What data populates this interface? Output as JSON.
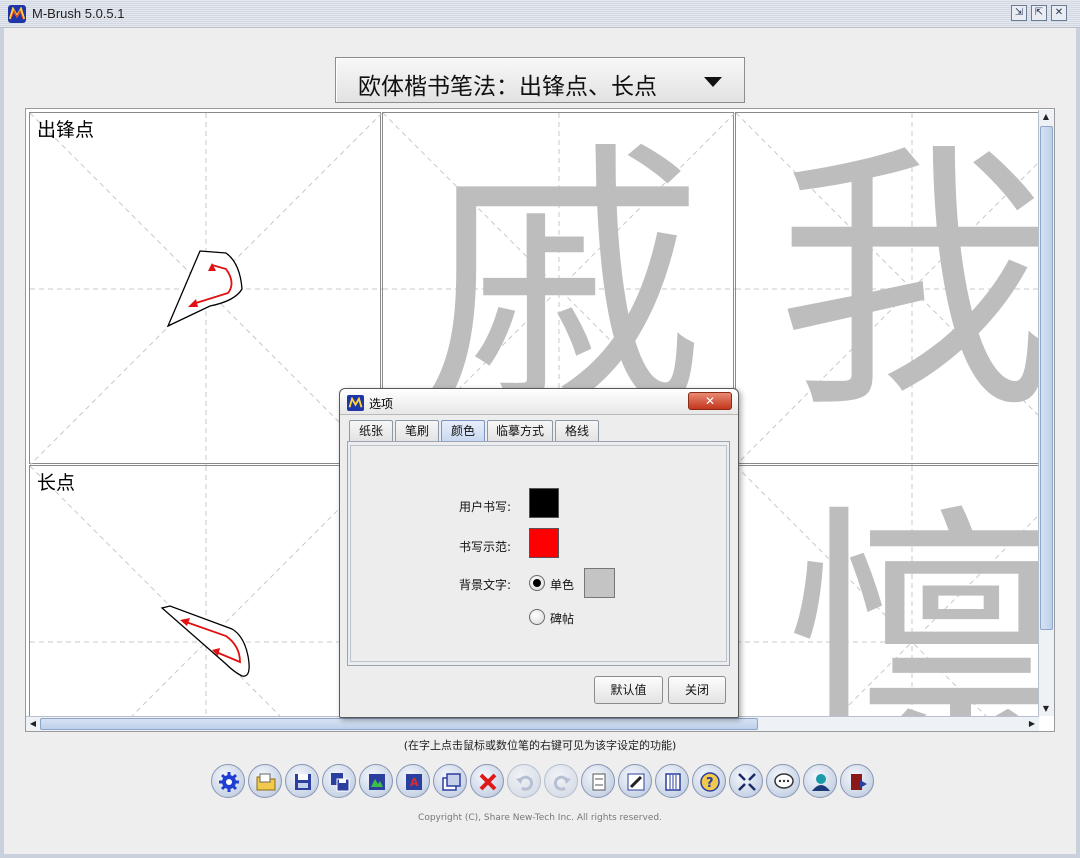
{
  "window": {
    "title": "M-Brush 5.0.5.1"
  },
  "lesson_selector": {
    "selected": "欧体楷书笔法：出锋点、长点"
  },
  "grid": {
    "cells": [
      {
        "label": "出锋点",
        "char": ""
      },
      {
        "label": "",
        "char": "戚"
      },
      {
        "label": "",
        "char": "我"
      },
      {
        "label": "长点",
        "char": ""
      },
      {
        "label": "",
        "char": ""
      },
      {
        "label": "",
        "char": "懔"
      }
    ]
  },
  "hint": "(在字上点击鼠标或数位笔的右键可见为该字设定的功能)",
  "toolbar": {
    "buttons": [
      "settings-icon",
      "open-icon",
      "save-icon",
      "save-as-icon",
      "image-icon",
      "font-icon",
      "copy-icon",
      "close-icon",
      "undo-icon",
      "redo-icon",
      "page-number-icon",
      "edit-icon",
      "book-icon",
      "help-icon",
      "fullscreen-icon",
      "chat-icon",
      "user-icon",
      "exit-icon"
    ]
  },
  "copyright": "Copyright (C), Share New-Tech Inc.  All rights reserved.",
  "dialog": {
    "title": "选项",
    "tabs": [
      "纸张",
      "笔刷",
      "颜色",
      "临摹方式",
      "格线"
    ],
    "active_tab": "颜色",
    "user_writing_label": "用户书写:",
    "demo_writing_label": "书写示范:",
    "bg_text_label": "背景文字:",
    "radio_single": "单色",
    "radio_rubbing": "碑帖",
    "default_button": "默认值",
    "close_button": "关闭",
    "colors": {
      "user_writing": "#000000",
      "demo_writing": "#ff0000",
      "single_color": "#c4c4c4"
    }
  }
}
